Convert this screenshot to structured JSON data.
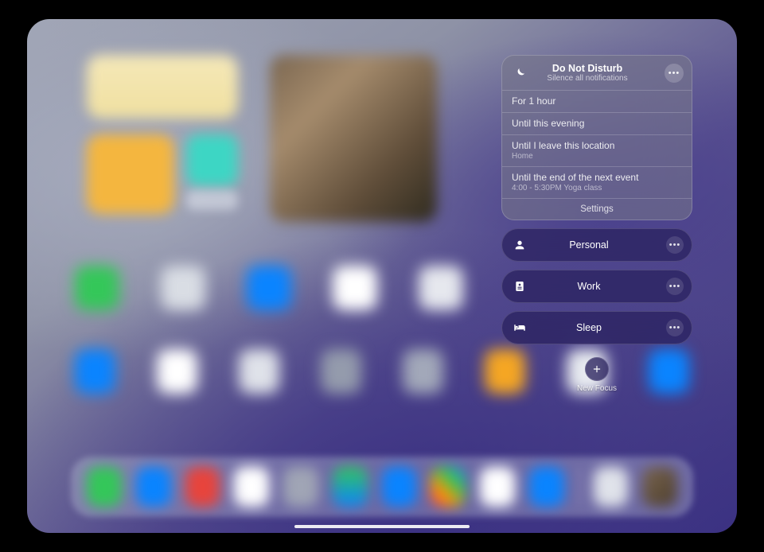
{
  "dnd": {
    "title": "Do Not Disturb",
    "subtitle": "Silence all notifications",
    "options": [
      {
        "label": "For 1 hour",
        "sub": ""
      },
      {
        "label": "Until this evening",
        "sub": ""
      },
      {
        "label": "Until I leave this location",
        "sub": "Home"
      },
      {
        "label": "Until the end of the next event",
        "sub": "4:00 - 5:30PM Yoga class"
      }
    ],
    "settings_label": "Settings"
  },
  "focus_modes": [
    {
      "key": "personal",
      "label": "Personal"
    },
    {
      "key": "work",
      "label": "Work"
    },
    {
      "key": "sleep",
      "label": "Sleep"
    }
  ],
  "new_focus_label": "New Focus"
}
